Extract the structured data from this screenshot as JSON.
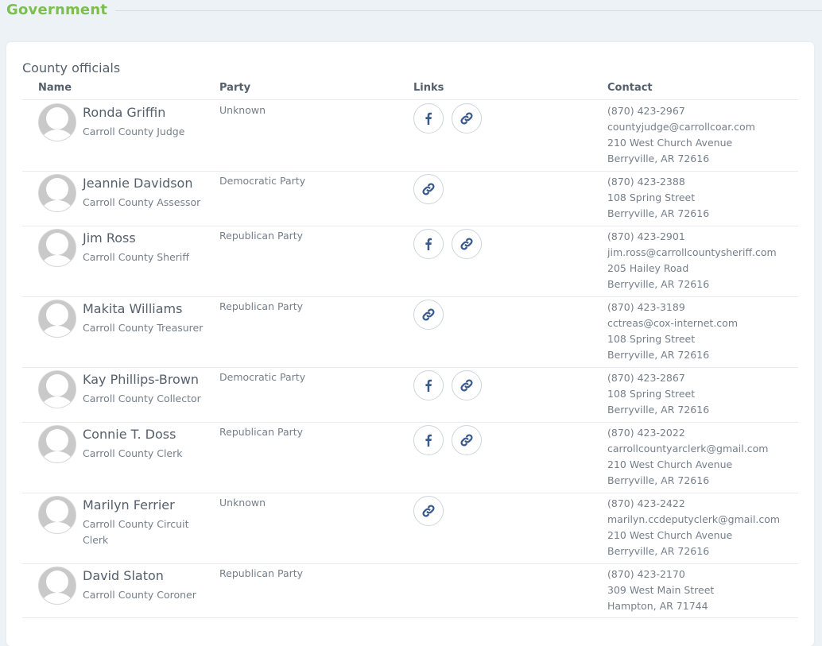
{
  "section": {
    "title": "Government"
  },
  "card": {
    "title": "County officials",
    "columns": {
      "name": "Name",
      "party": "Party",
      "links": "Links",
      "contact": "Contact"
    }
  },
  "officials": [
    {
      "name": "Ronda Griffin",
      "title": "Carroll County Judge",
      "party": "Unknown",
      "links": [
        "facebook-icon",
        "link-icon"
      ],
      "contact": [
        "(870) 423-2967",
        "countyjudge@carrollcoar.com",
        "210 West Church Avenue",
        "Berryville, AR 72616"
      ]
    },
    {
      "name": "Jeannie Davidson",
      "title": "Carroll County Assessor",
      "party": "Democratic Party",
      "links": [
        "link-icon"
      ],
      "contact": [
        "(870) 423-2388",
        "108 Spring Street",
        "Berryville, AR 72616"
      ]
    },
    {
      "name": "Jim Ross",
      "title": "Carroll County Sheriff",
      "party": "Republican Party",
      "links": [
        "facebook-icon",
        "link-icon"
      ],
      "contact": [
        "(870) 423-2901",
        "jim.ross@carrollcountysheriff.com",
        "205 Hailey Road",
        "Berryville, AR 72616"
      ]
    },
    {
      "name": "Makita Williams",
      "title": "Carroll County Treasurer",
      "party": "Republican Party",
      "links": [
        "link-icon"
      ],
      "contact": [
        "(870) 423-3189",
        "cctreas@cox-internet.com",
        "108 Spring Street",
        "Berryville, AR 72616"
      ]
    },
    {
      "name": "Kay Phillips-Brown",
      "title": "Carroll County Collector",
      "party": "Democratic Party",
      "links": [
        "facebook-icon",
        "link-icon"
      ],
      "contact": [
        "(870) 423-2867",
        "108 Spring Street",
        "Berryville, AR 72616"
      ]
    },
    {
      "name": "Connie T. Doss",
      "title": "Carroll County Clerk",
      "party": "Republican Party",
      "links": [
        "facebook-icon",
        "link-icon"
      ],
      "contact": [
        "(870) 423-2022",
        "carrollcountyarclerk@gmail.com",
        "210 West Church Avenue",
        "Berryville, AR 72616"
      ]
    },
    {
      "name": "Marilyn Ferrier",
      "title": "Carroll County Circuit Clerk",
      "party": "Unknown",
      "links": [
        "link-icon"
      ],
      "contact": [
        "(870) 423-2422",
        "marilyn.ccdeputyclerk@gmail.com",
        "210 West Church Avenue",
        "Berryville, AR 72616"
      ]
    },
    {
      "name": "David Slaton",
      "title": "Carroll County Coroner",
      "party": "Republican Party",
      "links": [],
      "contact": [
        "(870) 423-2170",
        "309 West Main Street",
        "Hampton, AR 71744"
      ]
    }
  ],
  "colors": {
    "accent": "#7cbf4e",
    "icon": "#3b5a8c",
    "background": "#edf2f7"
  }
}
